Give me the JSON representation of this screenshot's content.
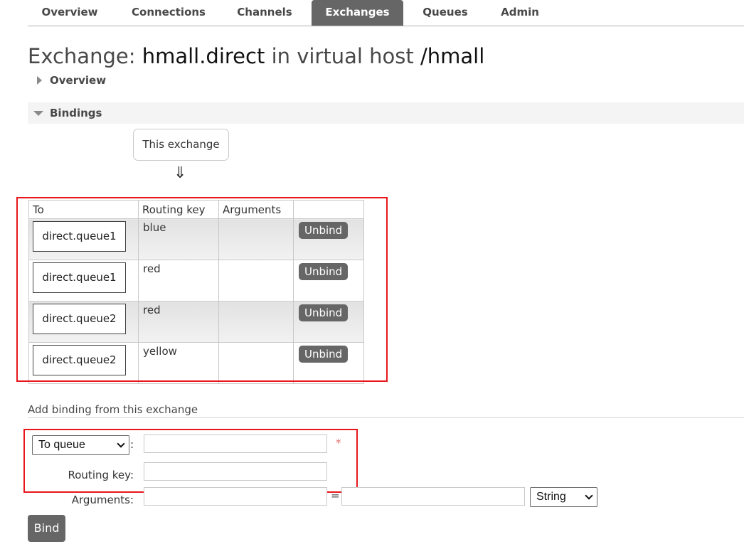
{
  "nav": {
    "tabs": [
      {
        "label": "Overview"
      },
      {
        "label": "Connections"
      },
      {
        "label": "Channels"
      },
      {
        "label": "Exchanges",
        "active": true
      },
      {
        "label": "Queues"
      },
      {
        "label": "Admin"
      }
    ]
  },
  "title": {
    "prefix": "Exchange:",
    "exchange": "hmall.direct",
    "middle": "in virtual host",
    "vhost": "/hmall"
  },
  "sections": {
    "overview": "Overview",
    "bindings": "Bindings"
  },
  "bindings": {
    "source_label": "This exchange",
    "arrow": "⇓",
    "headers": [
      "To",
      "Routing key",
      "Arguments",
      ""
    ],
    "rows": [
      {
        "to": "direct.queue1",
        "routing_key": "blue",
        "arguments": "",
        "action": "Unbind"
      },
      {
        "to": "direct.queue1",
        "routing_key": "red",
        "arguments": "",
        "action": "Unbind"
      },
      {
        "to": "direct.queue2",
        "routing_key": "red",
        "arguments": "",
        "action": "Unbind"
      },
      {
        "to": "direct.queue2",
        "routing_key": "yellow",
        "arguments": "",
        "action": "Unbind"
      }
    ]
  },
  "add_binding": {
    "heading": "Add binding from this exchange",
    "destination_type": "To queue",
    "destination_colon": ":",
    "destination_value": "",
    "required_mark": "*",
    "routing_key_label": "Routing key:",
    "routing_key_value": "",
    "arguments_label": "Arguments:",
    "arg_key": "",
    "equals": "=",
    "arg_value": "",
    "arg_type": "String",
    "submit_label": "Bind"
  },
  "colors": {
    "highlight": "#e8161b",
    "button_bg": "#666666"
  }
}
